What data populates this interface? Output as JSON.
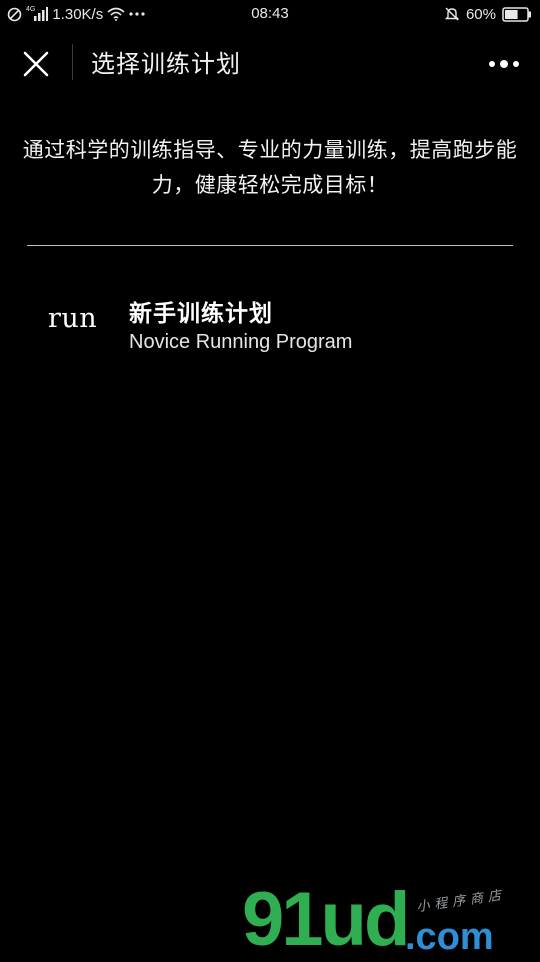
{
  "status_bar": {
    "network_speed": "1.30K/s",
    "signal_type": "4G",
    "time": "08:43",
    "battery": "60%",
    "battery_level": 0.6,
    "icons": [
      "no-disturb-icon",
      "signal-icon",
      "wifi-icon",
      "more-dots-icon",
      "mute-bell-icon",
      "battery-icon"
    ]
  },
  "nav": {
    "close_icon": "close-icon",
    "title": "选择训练计划",
    "more_icon": "more-dots-icon"
  },
  "intro": {
    "text": "通过科学的训练指导、专业的力量训练，提高跑步能力，健康轻松完成目标！"
  },
  "plans": [
    {
      "logo": "run",
      "title": "新手训练计划",
      "subtitle": "Novice Running Program"
    }
  ],
  "watermark": {
    "logo": "91ud",
    "domain": ".com",
    "tagline": "小程序商店"
  },
  "colors": {
    "background": "#000000",
    "text": "#ffffff",
    "divider": "#bdbdbd",
    "watermark_green": "#2fae52",
    "watermark_blue": "#2e8fd6"
  }
}
